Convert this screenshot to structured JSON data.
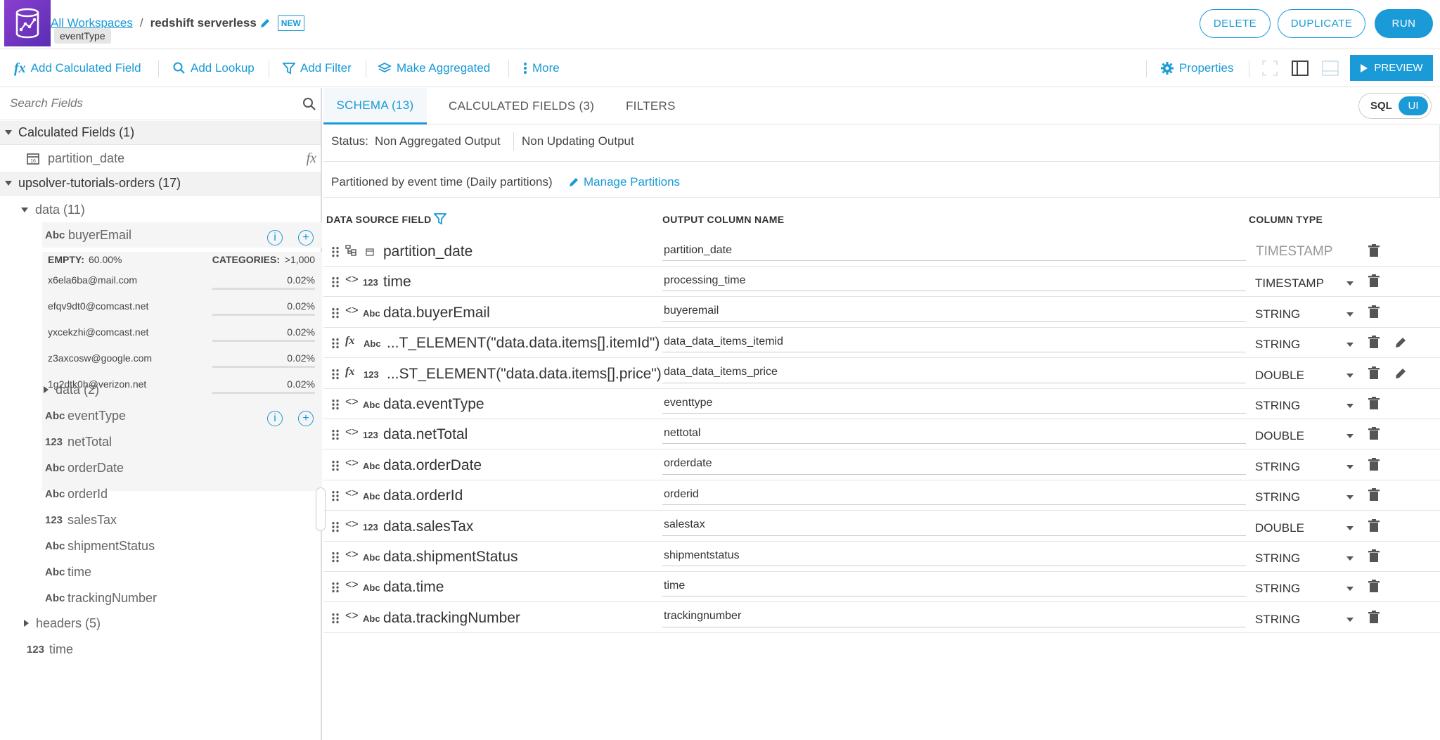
{
  "header": {
    "breadcrumb_root": "All Workspaces",
    "separator": "/",
    "workspace": "redshift serverless",
    "badge": "NEW",
    "tooltip": "eventType",
    "delete_label": "DELETE",
    "duplicate_label": "DUPLICATE",
    "run_label": "RUN"
  },
  "toolbar": {
    "add_calculated_field": "Add Calculated Field",
    "add_lookup": "Add Lookup",
    "add_filter": "Add Filter",
    "make_aggregated": "Make Aggregated",
    "more": "More",
    "properties": "Properties",
    "preview": "PREVIEW",
    "fx_glyph": "fx"
  },
  "sidebar": {
    "search_placeholder": "Search Fields",
    "calc_section": "Calculated Fields (1)",
    "calc_field": "partition_date",
    "source_section": "upsolver-tutorials-orders (17)",
    "data_group": "data (11)",
    "selected_field": {
      "type": "Abc",
      "name": "buyerEmail",
      "empty_label": "EMPTY:",
      "empty_value": "60.00%",
      "categories_label": "CATEGORIES:",
      "categories_value": ">1,000",
      "samples": [
        {
          "value": "x6ela6ba@mail.com",
          "pct": "0.02%"
        },
        {
          "value": "efqv9dt0@comcast.net",
          "pct": "0.02%"
        },
        {
          "value": "yxcekzhi@comcast.net",
          "pct": "0.02%"
        },
        {
          "value": "z3axcosw@google.com",
          "pct": "0.02%"
        },
        {
          "value": "1g2dtk0h@verizon.net",
          "pct": "0.02%"
        }
      ]
    },
    "nested_group": "data (2)",
    "fields": [
      {
        "type": "Abc",
        "name": "eventType"
      },
      {
        "type": "123",
        "name": "netTotal"
      },
      {
        "type": "Abc",
        "name": "orderDate"
      },
      {
        "type": "Abc",
        "name": "orderId"
      },
      {
        "type": "123",
        "name": "salesTax"
      },
      {
        "type": "Abc",
        "name": "shipmentStatus"
      },
      {
        "type": "Abc",
        "name": "time"
      },
      {
        "type": "Abc",
        "name": "trackingNumber"
      }
    ],
    "headers_group": "headers (5)",
    "root_field": {
      "type": "123",
      "name": "time"
    }
  },
  "tabs": {
    "schema": "SCHEMA (13)",
    "calculated": "CALCULATED FIELDS (3)",
    "filters": "FILTERS",
    "sql": "SQL",
    "ui": "UI"
  },
  "status": {
    "label": "Status:",
    "output": "Non Aggregated Output",
    "updating": "Non Updating Output"
  },
  "partition": {
    "text": "Partitioned by event time (Daily partitions)",
    "manage": "Manage Partitions"
  },
  "table": {
    "col_source": "DATA SOURCE FIELD",
    "col_output": "OUTPUT COLUMN NAME",
    "col_type": "COLUMN TYPE",
    "rows": [
      {
        "field": "partition_date",
        "output": "partition_date",
        "coltype": "TIMESTAMP"
      },
      {
        "field": "time",
        "type": "123",
        "output": "processing_time",
        "coltype": "TIMESTAMP"
      },
      {
        "field": "data.buyerEmail",
        "type": "Abc",
        "output": "buyeremail",
        "coltype": "STRING"
      },
      {
        "field": "...T_ELEMENT(\"data.data.items[].itemId\")",
        "type": "Abc",
        "output": "data_data_items_itemid",
        "coltype": "STRING"
      },
      {
        "field": "...ST_ELEMENT(\"data.data.items[].price\")",
        "type": "123",
        "output": "data_data_items_price",
        "coltype": "DOUBLE"
      },
      {
        "field": "data.eventType",
        "type": "Abc",
        "output": "eventtype",
        "coltype": "STRING"
      },
      {
        "field": "data.netTotal",
        "type": "123",
        "output": "nettotal",
        "coltype": "DOUBLE"
      },
      {
        "field": "data.orderDate",
        "type": "Abc",
        "output": "orderdate",
        "coltype": "STRING"
      },
      {
        "field": "data.orderId",
        "type": "Abc",
        "output": "orderid",
        "coltype": "STRING"
      },
      {
        "field": "data.salesTax",
        "type": "123",
        "output": "salestax",
        "coltype": "DOUBLE"
      },
      {
        "field": "data.shipmentStatus",
        "type": "Abc",
        "output": "shipmentstatus",
        "coltype": "STRING"
      },
      {
        "field": "data.time",
        "type": "Abc",
        "output": "time",
        "coltype": "STRING"
      },
      {
        "field": "data.trackingNumber",
        "type": "Abc",
        "output": "trackingnumber",
        "coltype": "STRING"
      }
    ]
  },
  "colors": {
    "accent": "#1a9ad6",
    "logo": "#7a35c8"
  }
}
